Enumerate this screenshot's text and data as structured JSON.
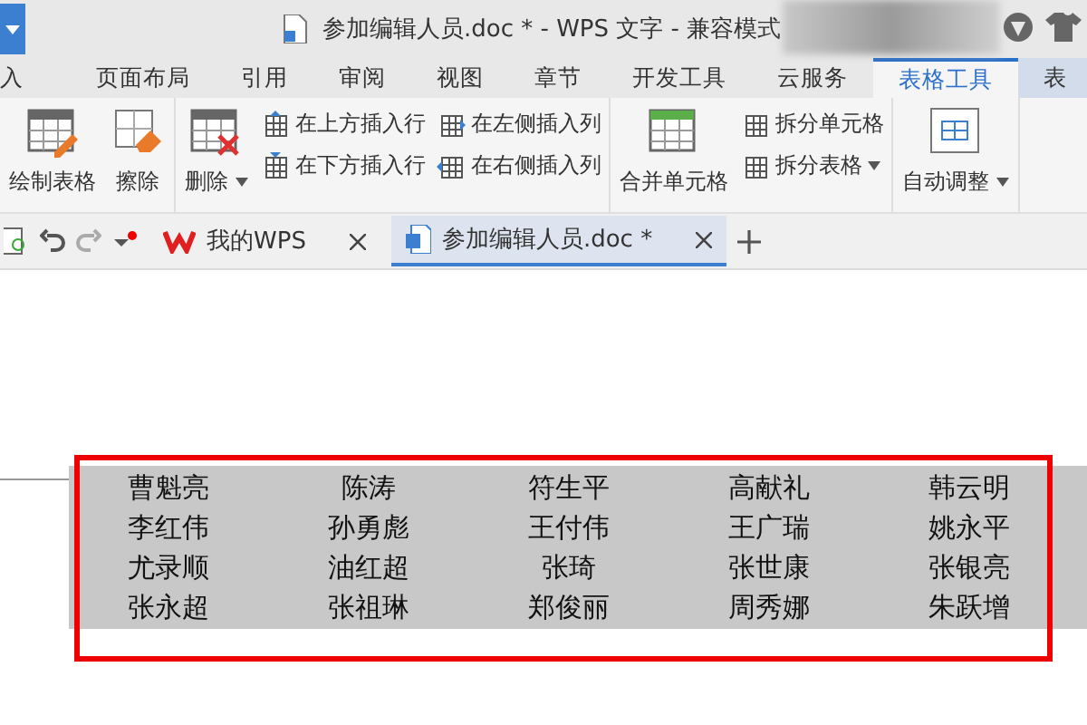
{
  "window": {
    "title": "参加编辑人员.doc * - WPS 文字 - 兼容模式"
  },
  "ribbon_tabs": [
    {
      "label": "入",
      "selected": false
    },
    {
      "label": "页面布局",
      "selected": false
    },
    {
      "label": "引用",
      "selected": false
    },
    {
      "label": "审阅",
      "selected": false
    },
    {
      "label": "视图",
      "selected": false
    },
    {
      "label": "章节",
      "selected": false
    },
    {
      "label": "开发工具",
      "selected": false
    },
    {
      "label": "云服务",
      "selected": false
    },
    {
      "label": "表格工具",
      "selected": true
    },
    {
      "label": "表",
      "selected": false
    }
  ],
  "ribbon": {
    "draw_table": "绘制表格",
    "erase": "擦除",
    "delete": "删除",
    "insert_above": "在上方插入行",
    "insert_below": "在下方插入行",
    "insert_left": "在左侧插入列",
    "insert_right": "在右侧插入列",
    "merge": "合并单元格",
    "split_cells": "拆分单元格",
    "split_table": "拆分表格",
    "autofit": "自动调整"
  },
  "doc_tabs": [
    {
      "label": "我的WPS",
      "selected": false
    },
    {
      "label": "参加编辑人员.doc *",
      "selected": true
    }
  ],
  "table": {
    "rows": [
      [
        "曹魁亮",
        "陈涛",
        "符生平",
        "高献礼",
        "韩云明"
      ],
      [
        "李红伟",
        "孙勇彪",
        "王付伟",
        "王广瑞",
        "姚永平"
      ],
      [
        "尤录顺",
        "油红超",
        "张琦",
        "张世康",
        "张银亮"
      ],
      [
        "张永超",
        "张祖琳",
        "郑俊丽",
        "周秀娜",
        "朱跃增"
      ]
    ]
  }
}
